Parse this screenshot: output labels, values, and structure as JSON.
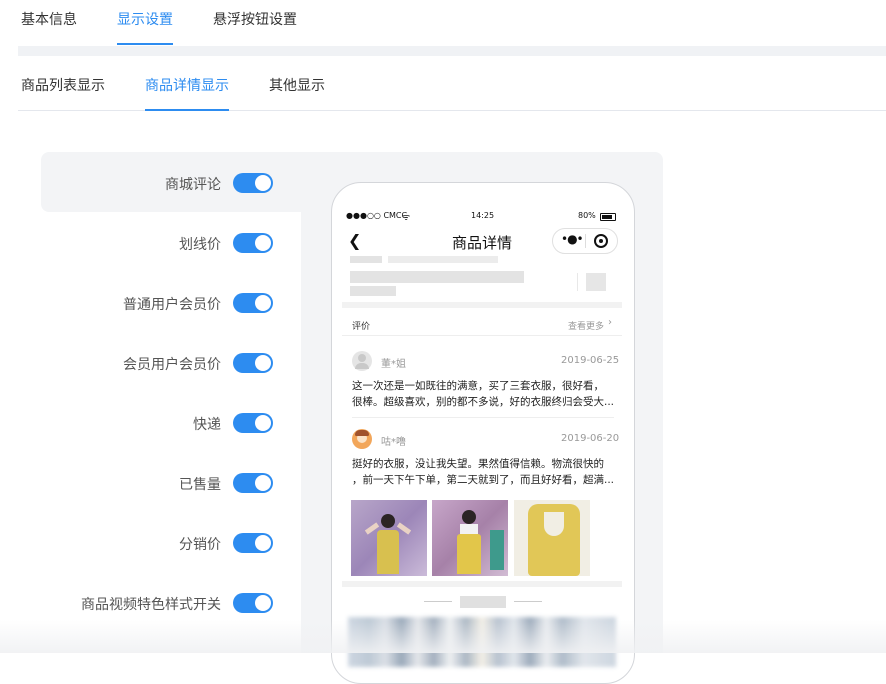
{
  "top_tabs": {
    "basic_info": "基本信息",
    "display_settings": "显示设置",
    "floating_button": "悬浮按钮设置"
  },
  "sub_tabs": {
    "list_display": "商品列表显示",
    "detail_display": "商品详情显示",
    "other_display": "其他显示"
  },
  "settings": [
    {
      "label": "商城评论",
      "on": true
    },
    {
      "label": "划线价",
      "on": true
    },
    {
      "label": "普通用户会员价",
      "on": true
    },
    {
      "label": "会员用户会员价",
      "on": true
    },
    {
      "label": "快递",
      "on": true
    },
    {
      "label": "已售量",
      "on": true
    },
    {
      "label": "分销价",
      "on": true
    },
    {
      "label": "商品视频特色样式开关",
      "on": true
    }
  ],
  "phone": {
    "status": {
      "carrier": "●●●○○ CMCC",
      "time": "14:25",
      "battery": "80%"
    },
    "nav_title": "商品详情",
    "review_header": "评价",
    "see_more": "查看更多",
    "reviews": [
      {
        "name": "董*姐",
        "date": "2019-06-25",
        "line1": "这一次还是一如既往的满意，买了三套衣服，很好看，",
        "line2": "很棒。超级喜欢，别的都不多说，好的衣服终归会受大..."
      },
      {
        "name": "咕*噜",
        "date": "2019-06-20",
        "line1": "挺好的衣服，没让我失望。果然值得信赖。物流很快的",
        "line2": "，前一天下午下单，第二天就到了，而且好好看，超满..."
      }
    ]
  },
  "colors": {
    "accent": "#2d8cf0",
    "panel": "#f3f4f6"
  }
}
